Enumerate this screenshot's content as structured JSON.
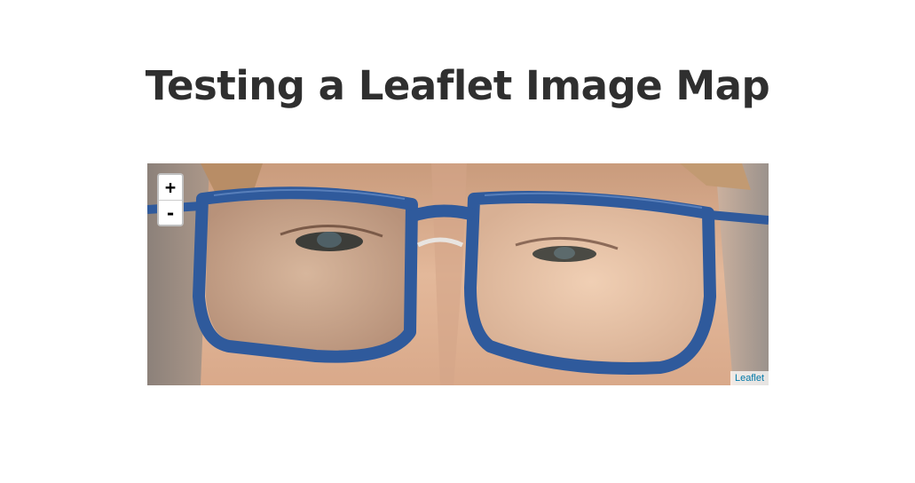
{
  "page": {
    "title": "Testing a Leaflet Image Map"
  },
  "map": {
    "image_subject": "face-with-blue-glasses",
    "zoom_in_label": "+",
    "zoom_out_label": "-",
    "attribution_link": "Leaflet"
  },
  "colors": {
    "title": "#2f2f2f",
    "glasses_frame": "#2f5a9c",
    "attribution_link": "#0078a8"
  }
}
